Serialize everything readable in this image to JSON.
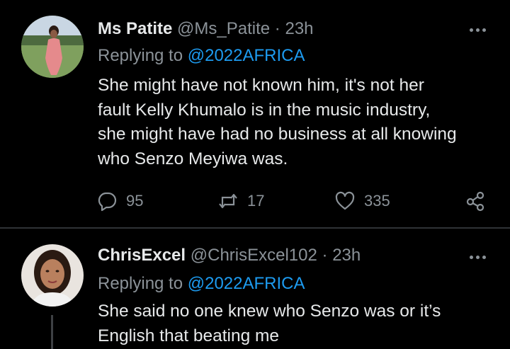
{
  "tweets": [
    {
      "name": "Ms Patite",
      "handle": "@Ms_Patite",
      "separator": "·",
      "time": "23h",
      "replying_prefix": "Replying to",
      "replying_to": "@2022AFRICA",
      "lines": [
        "She might have not known him, it's not her",
        "fault Kelly Khumalo is in the music industry,",
        "she might have had no business at all knowing",
        "who Senzo Meyiwa was."
      ],
      "reply_count": "95",
      "retweet_count": "17",
      "like_count": "335"
    },
    {
      "name": "ChrisExcel",
      "handle": "@ChrisExcel102",
      "separator": "·",
      "time": "23h",
      "replying_prefix": "Replying to",
      "replying_to": "@2022AFRICA",
      "lines": [
        "She said no one knew who Senzo was or it’s",
        "English that beating me"
      ]
    }
  ],
  "icons": {
    "reply": "reply-icon",
    "retweet": "retweet-icon",
    "like": "heart-icon",
    "share": "share-icon",
    "more": "more-icon"
  },
  "colors": {
    "background": "#000000",
    "text": "#e7e9ea",
    "secondary": "#8b9298",
    "link": "#1d9bf0",
    "divider": "#2f3336"
  }
}
